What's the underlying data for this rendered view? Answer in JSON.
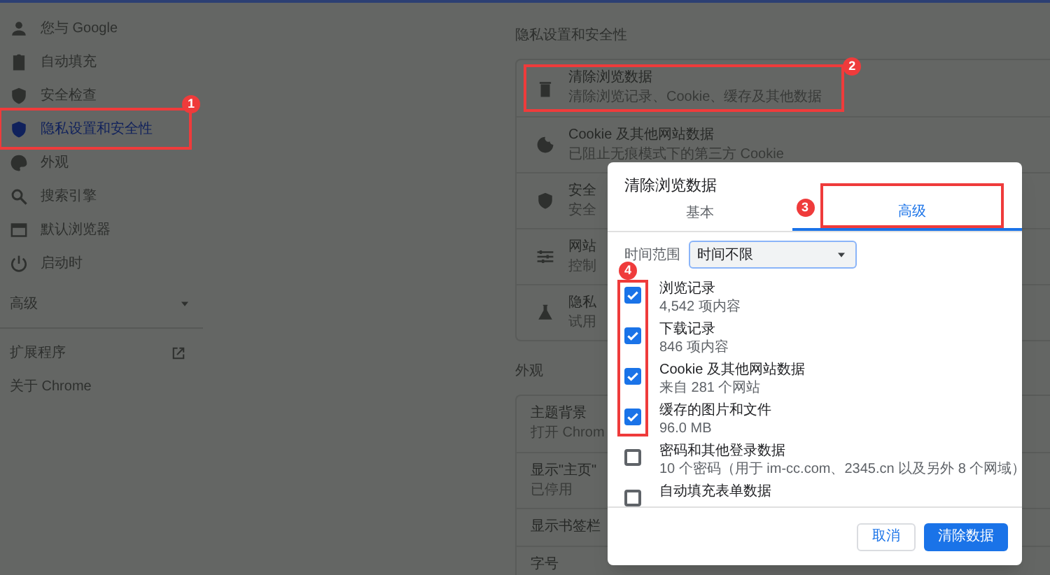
{
  "sidebar": {
    "items": [
      {
        "label": "您与 Google",
        "selected": false
      },
      {
        "label": "自动填充",
        "selected": false
      },
      {
        "label": "安全检查",
        "selected": false
      },
      {
        "label": "隐私设置和安全性",
        "selected": true,
        "annotation": "1"
      },
      {
        "label": "外观",
        "selected": false
      },
      {
        "label": "搜索引擎",
        "selected": false
      },
      {
        "label": "默认浏览器",
        "selected": false
      },
      {
        "label": "启动时",
        "selected": false
      }
    ],
    "advanced": {
      "label": "高级",
      "expanded": false
    },
    "links": [
      {
        "label": "扩展程序",
        "external": true
      },
      {
        "label": "关于 Chrome",
        "external": false
      }
    ]
  },
  "sections": [
    {
      "title": "隐私设置和安全性",
      "rows": [
        {
          "title": "清除浏览数据",
          "subtitle": "清除浏览记录、Cookie、缓存及其他数据",
          "annotation": "2"
        },
        {
          "title": "Cookie 及其他网站数据",
          "subtitle": "已阻止无痕模式下的第三方 Cookie"
        },
        {
          "title": "安全",
          "subtitle": "安全"
        },
        {
          "title": "网站",
          "subtitle": "控制"
        },
        {
          "title": "隐私",
          "subtitle": "试用"
        }
      ]
    },
    {
      "title": "外观",
      "rows": [
        {
          "title": "主题背景",
          "subtitle": "打开 Chrom"
        },
        {
          "title": "显示\"主页\"",
          "subtitle": "已停用"
        },
        {
          "title": "显示书签栏"
        },
        {
          "title": "字号"
        }
      ]
    }
  ],
  "dialog": {
    "title": "清除浏览数据",
    "tabs": [
      {
        "label": "基本",
        "selected": false
      },
      {
        "label": "高级",
        "selected": true,
        "annotation": "3"
      }
    ],
    "time_range": {
      "label": "时间范围",
      "value": "时间不限"
    },
    "checkbox_annotation": "4",
    "items": [
      {
        "title": "浏览记录",
        "subtitle": "4,542 项内容",
        "checked": true
      },
      {
        "title": "下载记录",
        "subtitle": "846 项内容",
        "checked": true
      },
      {
        "title": "Cookie 及其他网站数据",
        "subtitle": "来自 281 个网站",
        "checked": true
      },
      {
        "title": "缓存的图片和文件",
        "subtitle": "96.0 MB",
        "checked": true
      },
      {
        "title": "密码和其他登录数据",
        "subtitle": "10 个密码（用于 im-cc.com、2345.cn 以及另外 8 个网域）",
        "checked": false
      },
      {
        "title": "自动填充表单数据",
        "checked": false
      }
    ],
    "buttons": [
      {
        "label": "取消",
        "kind": "secondary"
      },
      {
        "label": "清除数据",
        "kind": "primary"
      }
    ]
  }
}
